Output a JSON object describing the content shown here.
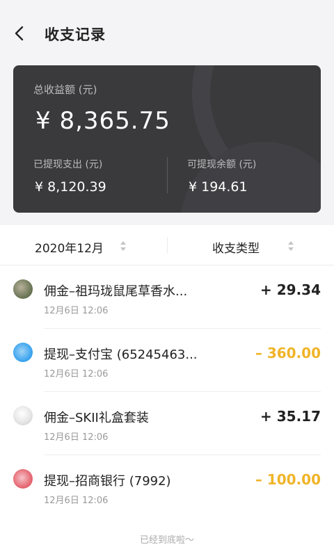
{
  "header": {
    "title": "收支记录",
    "back_icon": "chevron-left-icon"
  },
  "summary": {
    "total_label": "总收益额 (元)",
    "total_value": "¥ 8,365.75",
    "withdrawn_label": "已提现支出 (元)",
    "withdrawn_value": "¥ 8,120.39",
    "available_label": "可提现余额 (元)",
    "available_value": "¥ 194.61"
  },
  "filters": {
    "month": "2020年12月",
    "type": "收支类型",
    "sort_icon": "sort-arrows-icon"
  },
  "colors": {
    "income": "#222222",
    "withdraw": "#f0b429",
    "card_bg": "#3a3a3d"
  },
  "records": [
    {
      "title": "佣金–祖玛珑鼠尾草香水...",
      "time": "12月6日 12:06",
      "amount": "+ 29.34",
      "kind": "income",
      "avatar": "product-thumbnail"
    },
    {
      "title": "提现–支付宝 (65245463...",
      "time": "12月6日 12:06",
      "amount": "– 360.00",
      "kind": "withdraw",
      "avatar": "alipay-logo"
    },
    {
      "title": "佣金–SKII礼盒套装",
      "time": "12月6日 12:06",
      "amount": "+ 35.17",
      "kind": "income",
      "avatar": "product-thumbnail"
    },
    {
      "title": "提现–招商银行 (7992)",
      "time": "12月6日 12:06",
      "amount": "– 100.00",
      "kind": "withdraw",
      "avatar": "cmb-bank-logo"
    }
  ],
  "footer": {
    "end_text": "已经到底啦～"
  }
}
